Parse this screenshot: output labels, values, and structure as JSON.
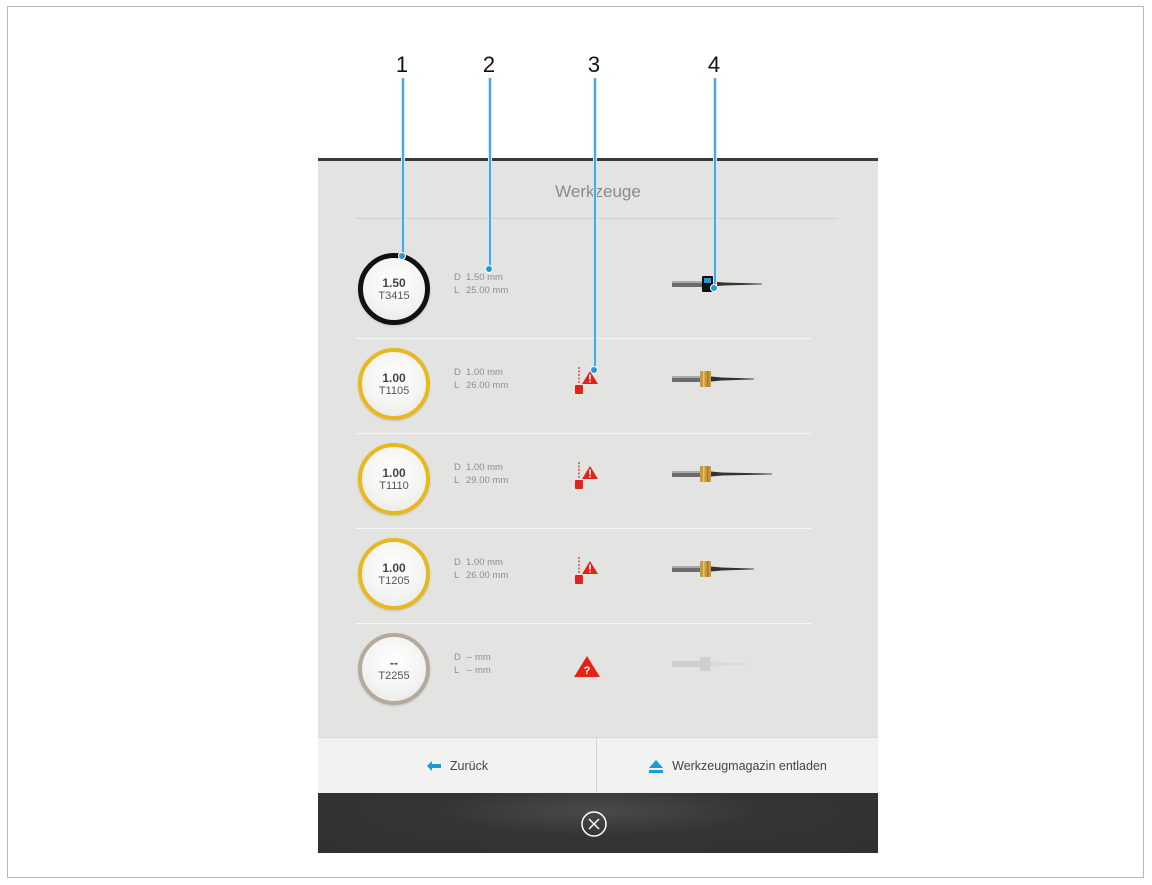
{
  "callouts": [
    "1",
    "2",
    "3",
    "4"
  ],
  "dialog": {
    "title": "Werkzeuge"
  },
  "tools": [
    {
      "value": "1.50",
      "id": "T3415",
      "d_label": "D",
      "d_value": "1.50 mm",
      "l_label": "L",
      "l_value": "25.00 mm",
      "ring_color": "#111111",
      "warning": "none",
      "holder_color": "#111111",
      "tool_state": "inserted"
    },
    {
      "value": "1.00",
      "id": "T1105",
      "d_label": "D",
      "d_value": "1.00 mm",
      "l_label": "L",
      "l_value": "26.00 mm",
      "ring_color": "#e8b820",
      "warning": "length-warning-icon",
      "holder_color": "#c99a3a",
      "tool_state": "available"
    },
    {
      "value": "1.00",
      "id": "T1110",
      "d_label": "D",
      "d_value": "1.00 mm",
      "l_label": "L",
      "l_value": "29.00 mm",
      "ring_color": "#e8b820",
      "warning": "length-warning-icon",
      "holder_color": "#c99a3a",
      "tool_state": "available"
    },
    {
      "value": "1.00",
      "id": "T1205",
      "d_label": "D",
      "d_value": "1.00 mm",
      "l_label": "L",
      "l_value": "26.00 mm",
      "ring_color": "#e8b820",
      "warning": "length-warning-icon",
      "holder_color": "#c99a3a",
      "tool_state": "available"
    },
    {
      "value": "--",
      "id": "T2255",
      "d_label": "D",
      "d_value": "-- mm",
      "l_label": "L",
      "l_value": "-- mm",
      "ring_color": "#b3aa9c",
      "warning": "unknown-tool-icon",
      "holder_color": "#d6d6d4",
      "tool_state": "unknown"
    }
  ],
  "buttons": {
    "back_label": "Zurück",
    "unload_label": "Werkzeugmagazin entladen"
  },
  "colors": {
    "accent": "#1e9ad6",
    "warning": "#e2231a",
    "panel_bg": "#e3e4e2",
    "footer_bg": "#333333"
  }
}
